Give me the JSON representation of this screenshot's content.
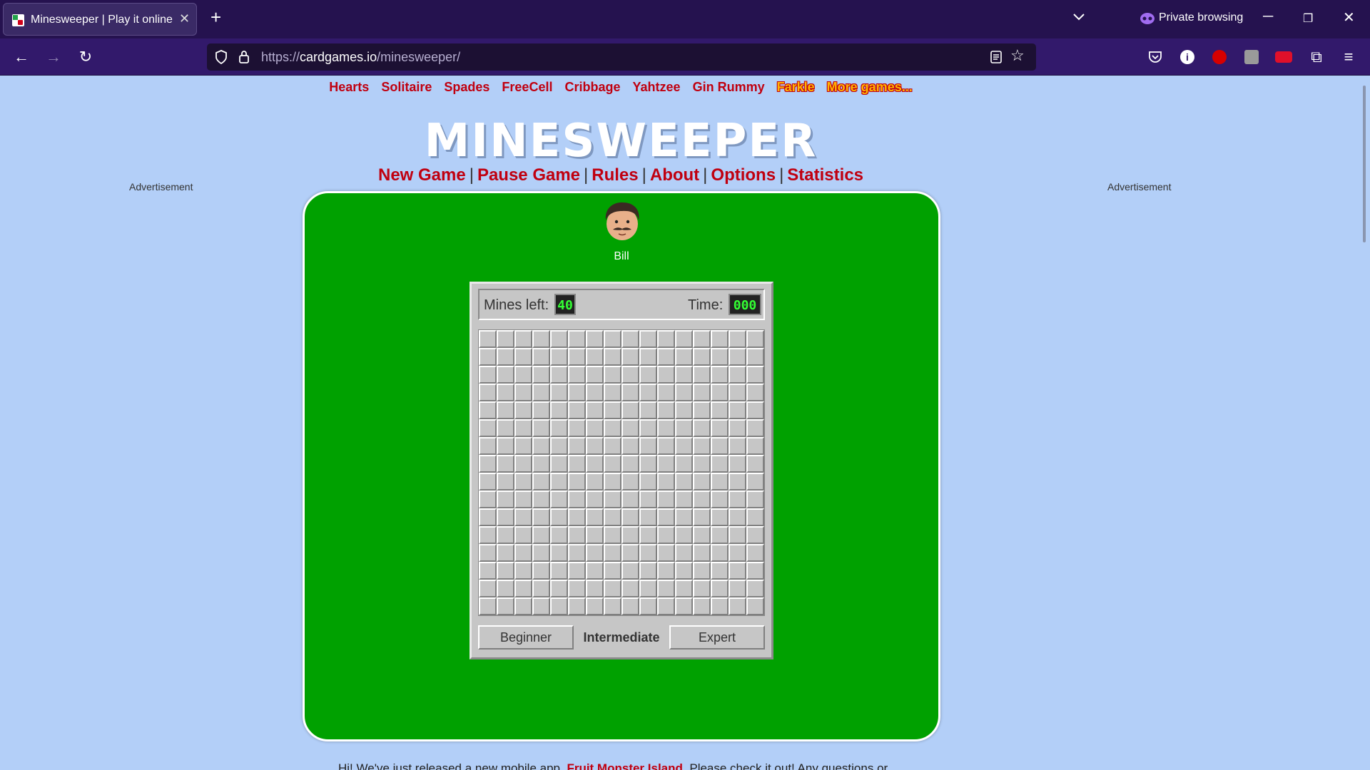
{
  "browser": {
    "tab_title": "Minesweeper | Play it online",
    "private_label": "Private browsing",
    "url_prefix": "https://",
    "url_host": "cardgames.io",
    "url_path": "/minesweeper/"
  },
  "top_nav": {
    "games": [
      "Hearts",
      "Solitaire",
      "Spades",
      "FreeCell",
      "Cribbage",
      "Yahtzee",
      "Gin Rummy"
    ],
    "featured": "Farkle",
    "more": "More games..."
  },
  "logo": "MINESWEEPER",
  "menu": {
    "new_game": "New Game",
    "pause": "Pause Game",
    "rules": "Rules",
    "about": "About",
    "options": "Options",
    "statistics": "Statistics",
    "separator": "|"
  },
  "ads": {
    "left": "Advertisement",
    "right": "Advertisement"
  },
  "player": {
    "name": "Bill"
  },
  "game": {
    "mines_label": "Mines left:",
    "mines_value": "40",
    "time_label": "Time:",
    "time_value": "000",
    "rows": 16,
    "cols": 16,
    "levels": [
      "Beginner",
      "Intermediate",
      "Expert"
    ],
    "active_level": "Intermediate"
  },
  "intro": {
    "before": "Hi! We've just released a new mobile app, ",
    "link": "Fruit Monster Island",
    "after": ". Please check it out! Any questions or"
  }
}
